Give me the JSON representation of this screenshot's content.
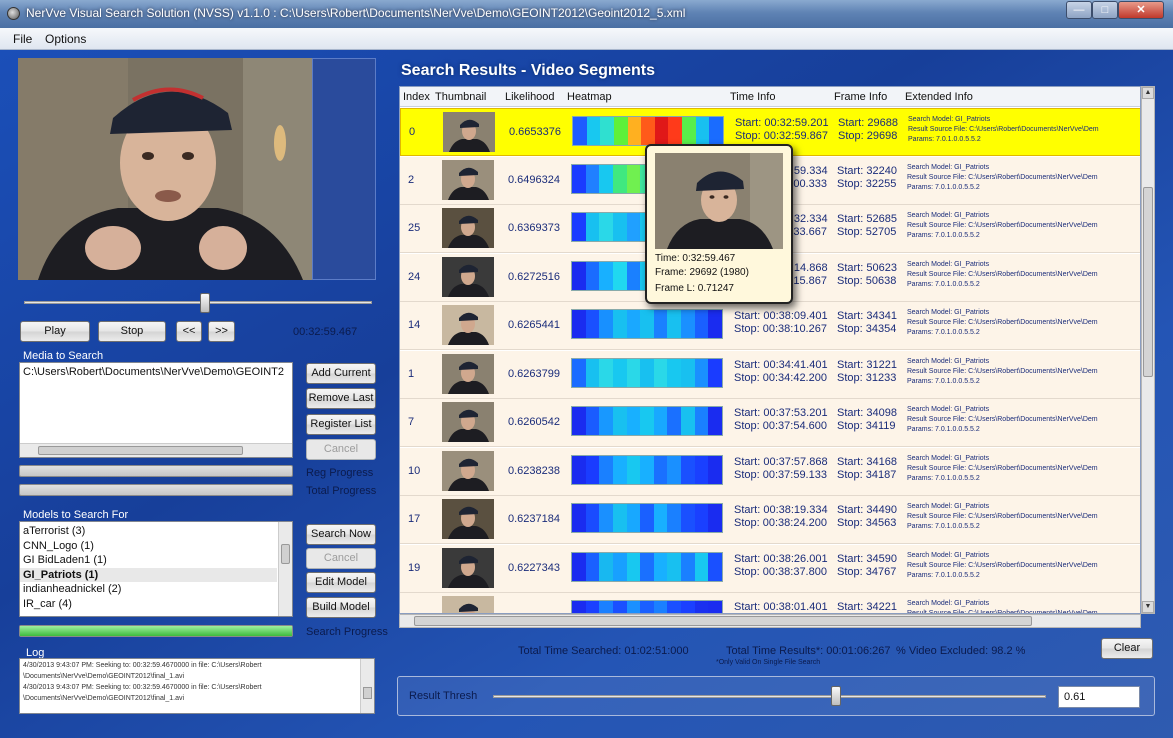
{
  "window": {
    "title": "NerVve Visual Search Solution (NVSS) v1.1.0 : C:\\Users\\Robert\\Documents\\NerVve\\Demo\\GEOINT2012\\Geoint2012_5.xml"
  },
  "menu": [
    "File",
    "Options"
  ],
  "player": {
    "play_label": "Play",
    "stop_label": "Stop",
    "rewind_label": "<<",
    "forward_label": ">>",
    "timestamp": "00:32:59.467",
    "slider_position": 0.52
  },
  "media": {
    "section_label": "Media to Search",
    "items": [
      "C:\\Users\\Robert\\Documents\\NerVve\\Demo\\GEOINT2"
    ],
    "buttons": {
      "add_current": "Add Current",
      "remove_last": "Remove Last",
      "register_list": "Register List",
      "cancel": "Cancel"
    },
    "reg_progress_label": "Reg Progress",
    "total_progress_label": "Total Progress"
  },
  "models": {
    "section_label": "Models to Search For",
    "items": [
      "aTerrorist (3)",
      "CNN_Logo (1)",
      "GI BidLaden1 (1)",
      "GI_Patriots (1)",
      "indianheadnickel (2)",
      "IR_car (4)"
    ],
    "selected_index": 3,
    "buttons": {
      "search_now": "Search Now",
      "cancel": "Cancel",
      "edit_model": "Edit Model",
      "build_model": "Build Model"
    },
    "search_progress_label": "Search Progress",
    "search_progress_value": 1.0
  },
  "log": {
    "label": "Log",
    "lines": [
      "4/30/2013 9:43:07 PM: Seeking to: 00:32:59.4670000 in file: C:\\Users\\Robert",
      "\\Documents\\NerVve\\Demo\\GEOINT2012\\final_1.avi",
      "4/30/2013 9:43:07 PM: Seeking to: 00:32:59.4670000 in file: C:\\Users\\Robert",
      "\\Documents\\NerVve\\Demo\\GEOINT2012\\final_1.avi"
    ]
  },
  "results": {
    "title": "Search Results - Video Segments",
    "columns": [
      "Index",
      "Thumbnail",
      "Likelihood",
      "Heatmap",
      "Time Info",
      "Frame Info",
      "Extended Info"
    ],
    "ext_lines": [
      "Search Model: GI_Patriots",
      "Result Source File: C:\\Users\\Robert\\Documents\\NerVve\\Dem",
      "Params: 7.0.1.0.0.5.5.2"
    ],
    "rows": [
      {
        "index": "0",
        "likelihood": "0.6653376",
        "start_time": "Start: 00:32:59.201",
        "stop_time": "Stop: 00:32:59.867",
        "start_frame": "Start: 29688",
        "stop_frame": "Stop: 29698",
        "selected": true
      },
      {
        "index": "2",
        "likelihood": "0.6496324",
        "start_time": "Start: 00:32:59.334",
        "stop_time": "Stop: 00:33:00.333",
        "start_frame": "Start: 32240",
        "stop_frame": "Stop: 32255"
      },
      {
        "index": "25",
        "likelihood": "0.6369373",
        "start_time": "Start: 00:32:32.334",
        "stop_time": "Stop: 00:32:33.667",
        "start_frame": "Start: 52685",
        "stop_frame": "Stop: 52705"
      },
      {
        "index": "24",
        "likelihood": "0.6272516",
        "start_time": "Start: 00:32:14.868",
        "stop_time": "Stop: 00:32:15.867",
        "start_frame": "Start: 50623",
        "stop_frame": "Stop: 50638"
      },
      {
        "index": "14",
        "likelihood": "0.6265441",
        "start_time": "Start: 00:38:09.401",
        "stop_time": "Stop: 00:38:10.267",
        "start_frame": "Start: 34341",
        "stop_frame": "Stop: 34354"
      },
      {
        "index": "1",
        "likelihood": "0.6263799",
        "start_time": "Start: 00:34:41.401",
        "stop_time": "Stop: 00:34:42.200",
        "start_frame": "Start: 31221",
        "stop_frame": "Stop: 31233"
      },
      {
        "index": "7",
        "likelihood": "0.6260542",
        "start_time": "Start: 00:37:53.201",
        "stop_time": "Stop: 00:37:54.600",
        "start_frame": "Start: 34098",
        "stop_frame": "Stop: 34119"
      },
      {
        "index": "10",
        "likelihood": "0.6238238",
        "start_time": "Start: 00:37:57.868",
        "stop_time": "Stop: 00:37:59.133",
        "start_frame": "Start: 34168",
        "stop_frame": "Stop: 34187"
      },
      {
        "index": "17",
        "likelihood": "0.6237184",
        "start_time": "Start: 00:38:19.334",
        "stop_time": "Stop: 00:38:24.200",
        "start_frame": "Start: 34490",
        "stop_frame": "Stop: 34563"
      },
      {
        "index": "19",
        "likelihood": "0.6227343",
        "start_time": "Start: 00:38:26.001",
        "stop_time": "Stop: 00:38:37.800",
        "start_frame": "Start: 34590",
        "stop_frame": "Stop: 34767"
      },
      {
        "index": "",
        "likelihood": "",
        "start_time": "Start: 00:38:01.401",
        "stop_time": "",
        "start_frame": "Start: 34221",
        "stop_frame": ""
      }
    ]
  },
  "tooltip": {
    "time": "Time: 0:32:59.467",
    "frame": "Frame: 29692 (1980)",
    "frame_l": "Frame L: 0.71247"
  },
  "summary": {
    "total_time_searched": "Total Time Searched: 01:02:51:000",
    "total_time_results": "Total Time Results*: 00:01:06:267",
    "video_excluded": "% Video Excluded: 98.2 %",
    "note": "*Only Valid On Single File Search",
    "clear_label": "Clear"
  },
  "threshold": {
    "label": "Result Thresh",
    "value": "0.61",
    "slider_position": 0.62
  },
  "colors": {
    "selected_row": "#ffff00",
    "row_bg": "#fdf4e8",
    "title_blue": "#1b4fb8",
    "progress_green": "#5fd35f"
  }
}
